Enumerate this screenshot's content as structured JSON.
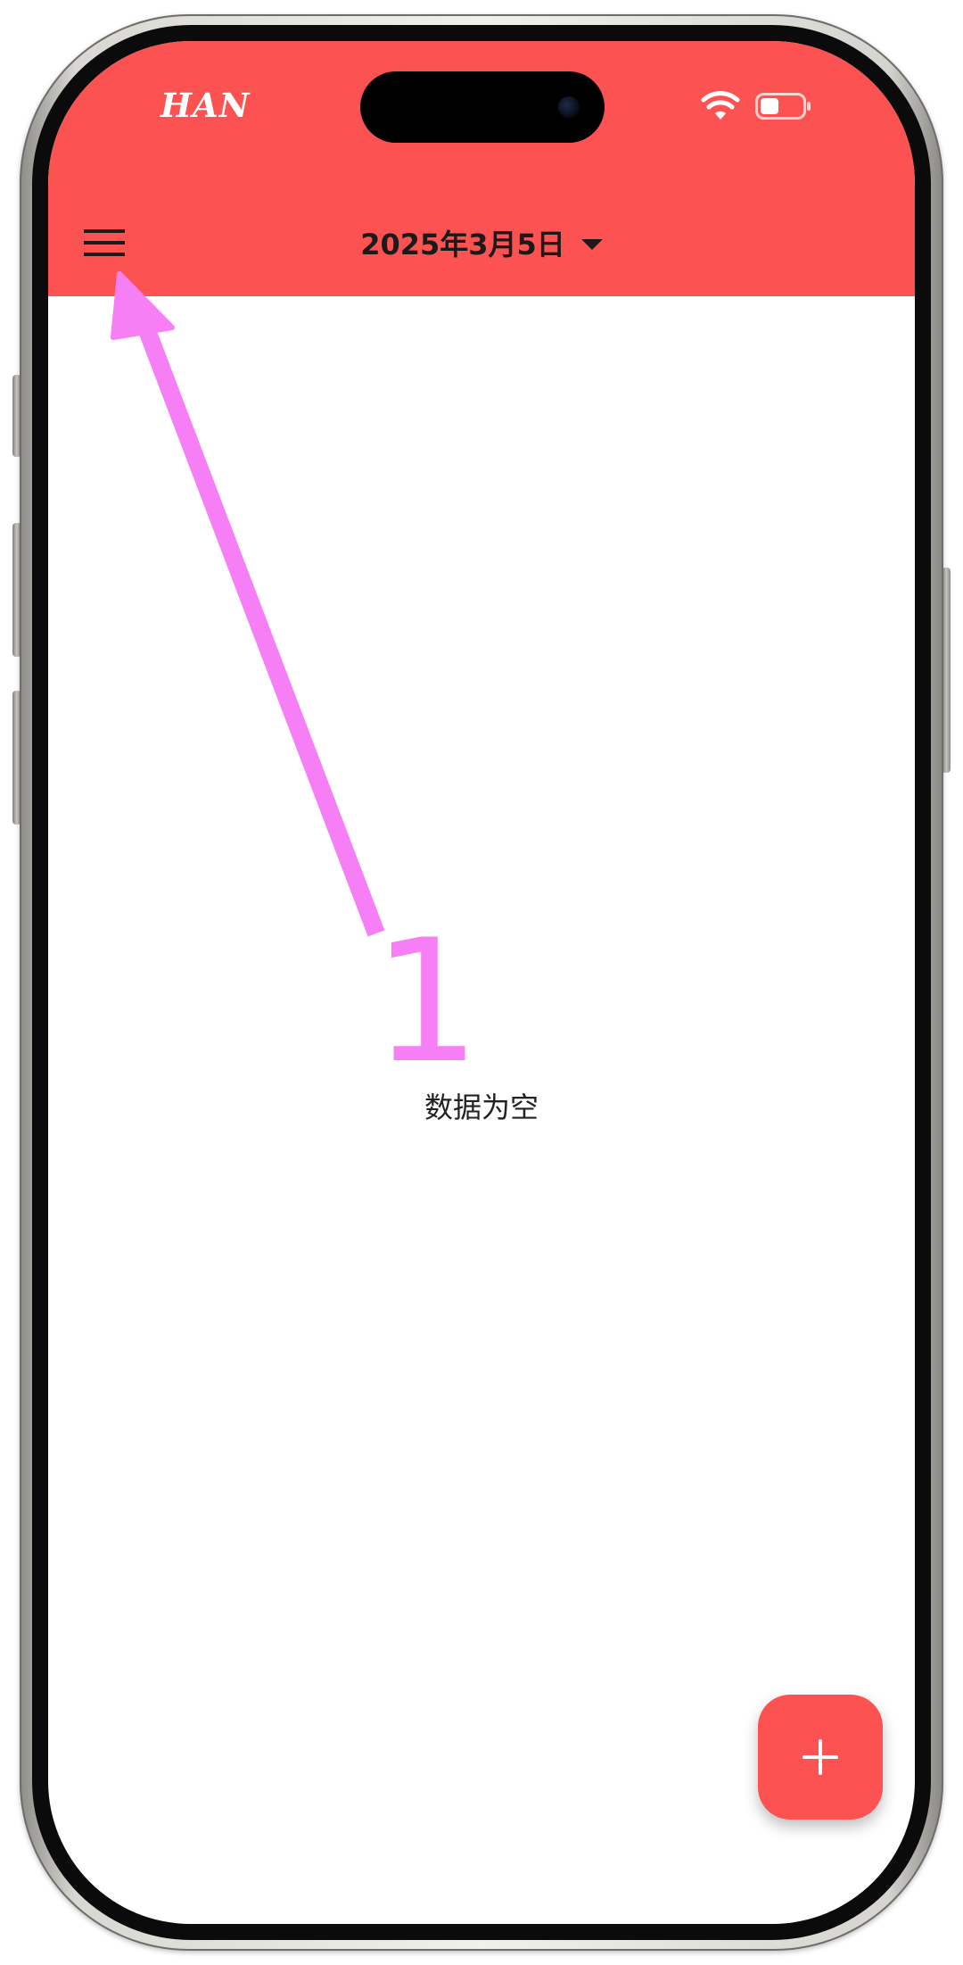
{
  "status_bar": {
    "carrier": "HAN",
    "wifi_icon": "wifi-icon",
    "battery_icon": "battery-icon"
  },
  "app_bar": {
    "menu_icon": "hamburger-menu-icon",
    "title": "2025年3月5日",
    "dropdown_icon": "caret-down-icon"
  },
  "main": {
    "empty_text": "数据为空"
  },
  "fab": {
    "icon": "plus-icon"
  },
  "annotation": {
    "step_number": "1",
    "color": "#f77ff6"
  },
  "colors": {
    "accent": "#fc5352",
    "background": "#ffffff",
    "title_text": "#1a1a1a"
  }
}
